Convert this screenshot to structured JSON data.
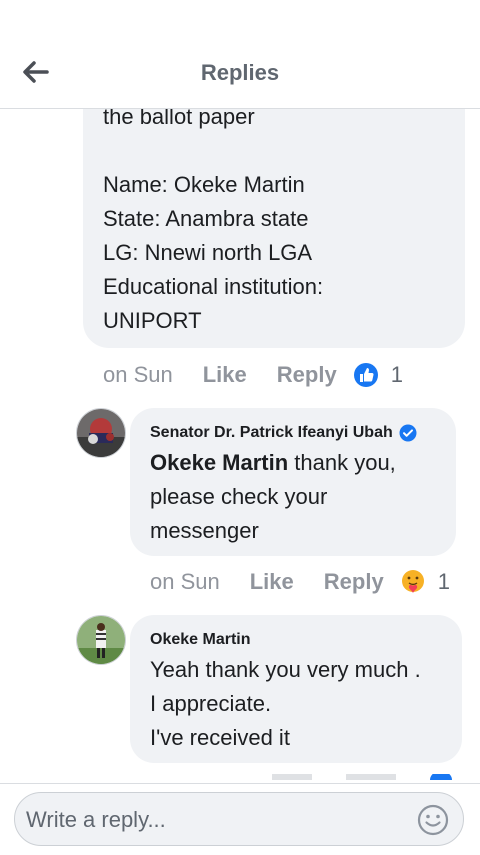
{
  "header": {
    "title": "Replies",
    "back_icon": "arrow-left-icon"
  },
  "comment_top": {
    "lines": [
      "the ballot paper",
      "",
      "Name: Okeke Martin",
      "State: Anambra state",
      "LG: Nnewi north LGA",
      "Educational institution:",
      "UNIPORT"
    ],
    "time": "on Sun",
    "like_label": "Like",
    "reply_label": "Reply",
    "reaction_icon": "like-reaction-icon",
    "reaction_count": "1"
  },
  "reply1": {
    "author": "Senator Dr. Patrick Ifeanyi Ubah",
    "verified_icon": "verified-badge-icon",
    "mention": "Okeke Martin",
    "line1_rest": " thank you,",
    "line2": "please check your",
    "line3": "messenger",
    "time": "on Sun",
    "like_label": "Like",
    "reply_label": "Reply",
    "reaction_icon": "care-reaction-icon",
    "reaction_count": "1"
  },
  "reply2": {
    "author": "Okeke Martin",
    "lines": [
      "Yeah thank you very much .",
      "I appreciate.",
      "I've received it"
    ]
  },
  "footer": {
    "placeholder": "Write a reply...",
    "emoji_icon": "smiley-icon"
  },
  "colors": {
    "bubble": "#f0f2f5",
    "like_blue": "#1877f2",
    "meta_gray": "#90949c"
  }
}
